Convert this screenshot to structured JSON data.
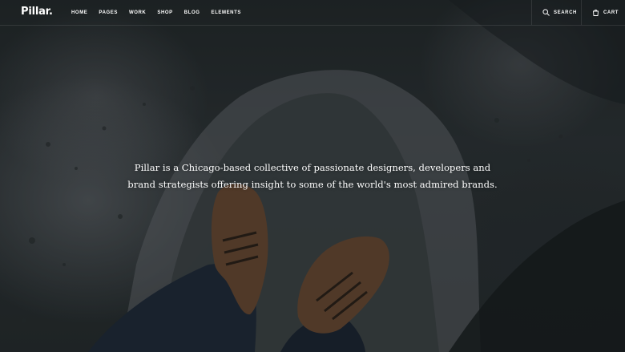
{
  "header": {
    "logo": "Pillar.",
    "nav": [
      {
        "label": "HOME"
      },
      {
        "label": "PAGES"
      },
      {
        "label": "WORK"
      },
      {
        "label": "SHOP"
      },
      {
        "label": "BLOG"
      },
      {
        "label": "ELEMENTS"
      }
    ],
    "search_label": "SEARCH",
    "cart_label": "CART",
    "search_icon": "search-icon",
    "cart_icon": "shopping-bag-icon"
  },
  "hero": {
    "text": "Pillar is a Chicago-based collective of passionate designers, developers and brand strategists offering insight to some of the world's most admired brands.",
    "image_subject": "top-down view of brown leather boots standing on a rock",
    "colors": {
      "stone": "#5f646a",
      "dark_rock": "#1e2426",
      "boot": "#6b4a33",
      "jeans": "#1f2a3a"
    }
  }
}
